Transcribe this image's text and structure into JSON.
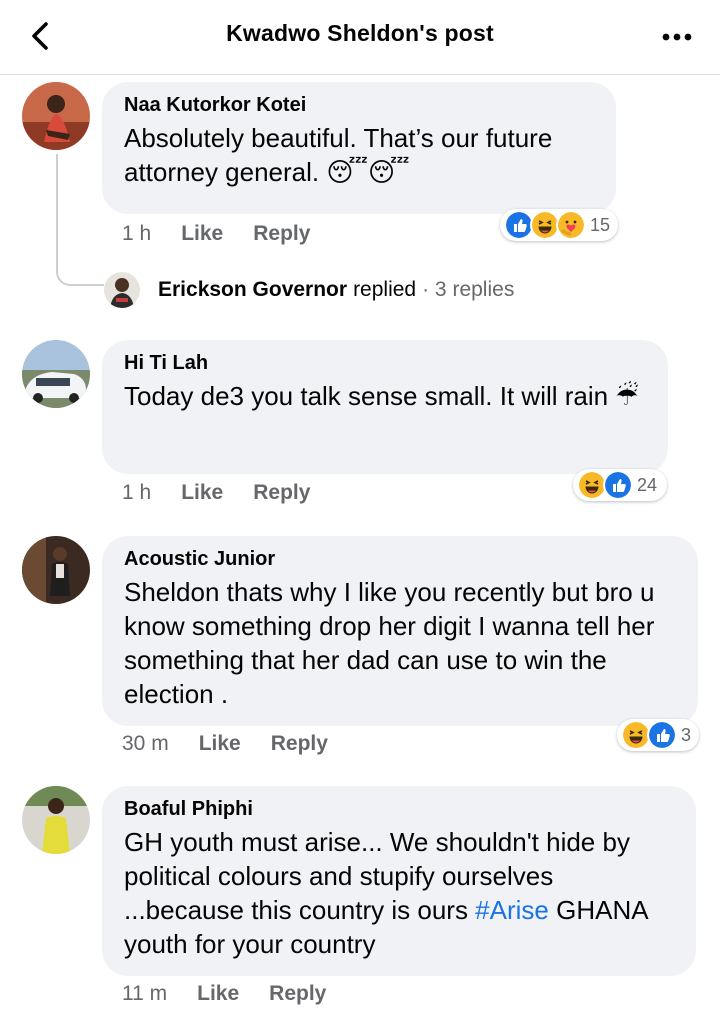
{
  "header": {
    "title": "Kwadwo Sheldon's post"
  },
  "comments": [
    {
      "author": "Naa Kutorkor Kotei",
      "text": "Absolutely beautiful. That’s our future attorney general. 😴😴",
      "time": "1 h",
      "like": "Like",
      "reply": "Reply",
      "reactions": {
        "icons": [
          "like-icon",
          "haha-icon",
          "care-icon"
        ],
        "count": "15"
      }
    },
    {
      "author": "Hi Ti Lah",
      "text": "Today de3 you talk sense small. It will rain ☔",
      "time": "1 h",
      "like": "Like",
      "reply": "Reply",
      "reactions": {
        "icons": [
          "haha-icon",
          "like-icon"
        ],
        "count": "24"
      }
    },
    {
      "author": "Acoustic Junior",
      "text": "Sheldon thats why I like you recently but bro u know something drop her digit I wanna tell her something that her dad can use to win the election .",
      "time": "30 m",
      "like": "Like",
      "reply": "Reply",
      "reactions": {
        "icons": [
          "haha-icon",
          "like-icon"
        ],
        "count": "3"
      }
    },
    {
      "author": "Boaful Phiphi",
      "text_before": "GH youth must arise... We shouldn't hide by political colours and stupify ourselves  ...because this country is ours ",
      "hashtag": "#Arise",
      "text_after": " GHANA youth for your country",
      "time": "11 m",
      "like": "Like",
      "reply": "Reply"
    }
  ],
  "replies_row": {
    "name": "Erickson Governor",
    "action": "replied",
    "extra": "· 3 replies"
  },
  "colors": {
    "bubble": "#f0f2f5",
    "like_blue": "#1b74e4",
    "meta_gray": "#65676b",
    "haha_yellow": "#f7b928"
  }
}
